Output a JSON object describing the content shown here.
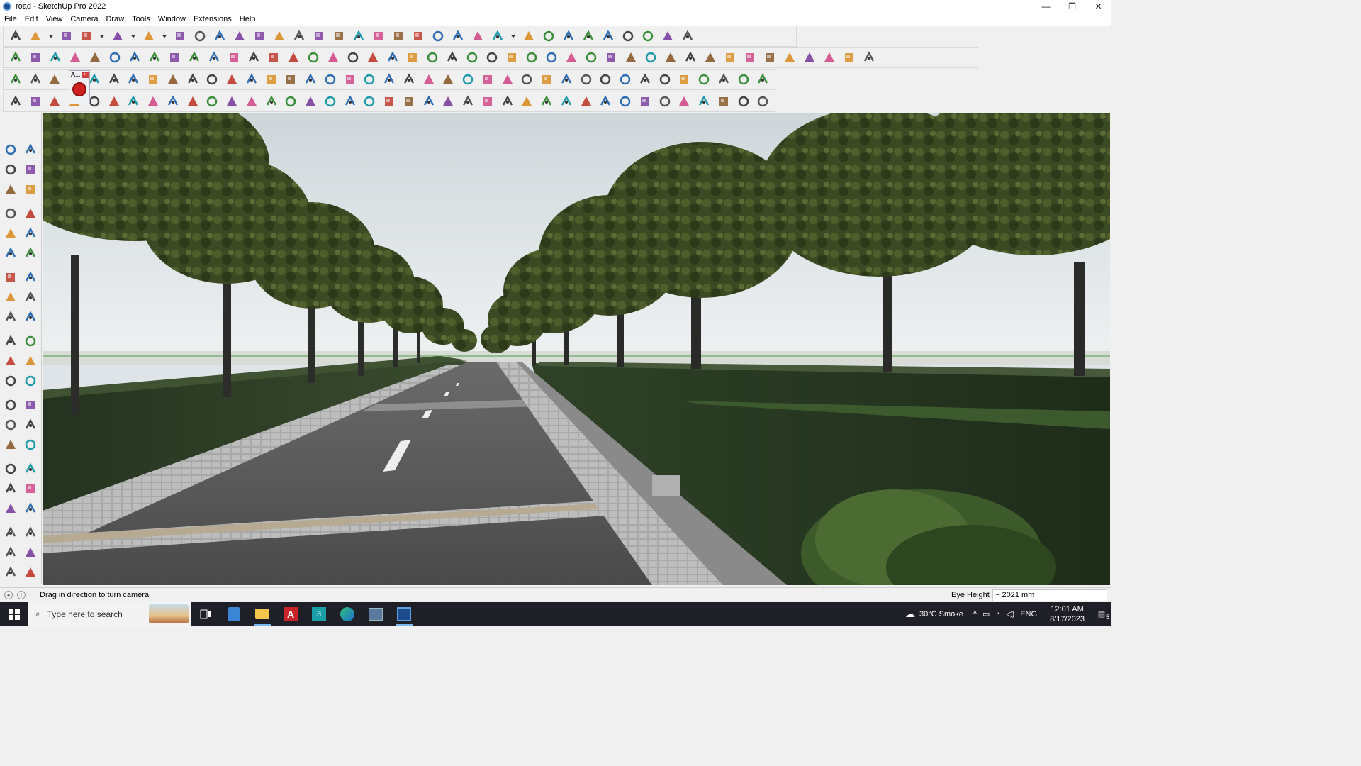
{
  "window": {
    "title": "road - SketchUp Pro 2022",
    "controls": [
      "—",
      "❐",
      "✕"
    ]
  },
  "menu": [
    "File",
    "Edit",
    "View",
    "Camera",
    "Draw",
    "Tools",
    "Window",
    "Extensions",
    "Help"
  ],
  "toolbars": {
    "row1_icons": [
      "zoom-icon",
      "select-icon",
      "dropdown-icon",
      "eraser-icon",
      "pencil-line-icon",
      "dropdown-icon",
      "arc-icon",
      "dropdown-icon",
      "rectangle-icon",
      "dropdown-icon",
      "push-pull-icon",
      "follow-me-icon",
      "move-icon",
      "rotate-icon",
      "scale-icon",
      "tape-measure-icon",
      "text-icon",
      "paint-bucket-icon",
      "orbit-icon",
      "pan-icon",
      "zoom-window-icon",
      "zoom-extents-icon",
      "previous-view-icon",
      "section-plane-icon",
      "section-fill-icon",
      "layers-icon",
      "styles-icon",
      "dropdown-icon",
      "warehouse-icon",
      "extension-warehouse-icon",
      "layout-icon",
      "sandbox-icon",
      "flip-icon",
      "solid-tools-icon",
      "undo-icon",
      "redo-icon",
      "hand-icon"
    ],
    "row2_icons": [
      "iso-view-icon",
      "top-view-icon",
      "front-view-icon",
      "axes-red-icon",
      "axes-blue-icon",
      "axes-purple-icon",
      "axes-green-icon",
      "axes-orange-icon",
      "axes-yellow-icon",
      "axes-pink-icon",
      "smooth-icon",
      "plane-blue-icon",
      "plane-blue-2-icon",
      "plane-purple-icon",
      "green-block-icon",
      "green-block-2-icon",
      "house-icon",
      "house-2-icon",
      "house-3-icon",
      "house-4-icon",
      "house-5-icon",
      "house-6-icon",
      "fx-icon",
      "curve-icon",
      "pencil-red-icon",
      "shape-square-icon",
      "shape-circle-icon",
      "shape-hex-icon",
      "shape-ellipse-icon",
      "shape-parallelogram-icon",
      "shape-arc-icon",
      "shape-spiral-icon",
      "shape-knot-icon",
      "shape-blue-icon",
      "shape-grey-icon",
      "tape-red-icon",
      "eraser-pink-icon",
      "roof-icon",
      "brick-icon",
      "roof-red-icon",
      "roof-gray-icon",
      "roof-white-icon",
      "panel-icon",
      "panel-2-icon"
    ],
    "row3_icons": [
      "blue-box-icon",
      "blue-face-icon",
      "yellow-face-icon",
      "text-label-icon",
      "red-face-icon",
      "flat-face-icon",
      "orange-arc-icon",
      "red-square-icon",
      "stack-icon",
      "frame-icon",
      "wood-icon",
      "link-icon",
      "bend-icon",
      "node-icon",
      "cross-red-icon",
      "cross-green-icon",
      "cross-blue-icon",
      "cone-icon",
      "tent-icon",
      "pyramid-icon",
      "hook-icon",
      "spiral-red-icon",
      "spiral-dark-icon",
      "move-blue-icon",
      "box-red-icon",
      "magnet-icon",
      "tree-icon",
      "cube-arrow-icon",
      "cube-red-icon",
      "cube-yellow-icon",
      "star-icon",
      "gears-icon",
      "window-frame-icon",
      "grid-orange-icon",
      "grid-orange-2-icon",
      "grid-orange-3-icon",
      "dots-icon",
      "dash-circle-icon",
      "multi-grid-icon"
    ],
    "row4_icons": [
      "path-icon",
      "path-red-icon",
      "car-icon",
      "gear-icon",
      "hand-curve-icon",
      "plane-flat-icon",
      "sphere-icon",
      "dome-icon",
      "arc-tool-icon",
      "stairs-icon",
      "stairs-2-icon",
      "line-red-icon",
      "curve-red-icon",
      "wheel-icon",
      "sail-icon",
      "comb-icon",
      "comb-2-icon",
      "hand-grid-icon",
      "leaf-icon",
      "leaf-2-icon",
      "fan-icon",
      "slash-icon",
      "slash-2-icon",
      "slash-3-icon",
      "slash-4-icon",
      "grid-dark-icon",
      "grid-dark-2-icon",
      "grid-dark-3-icon",
      "tile-icon",
      "tile-2-icon",
      "tile-3-icon",
      "hatch-icon",
      "hatch-2-icon",
      "hatch-3-icon",
      "hatch-4-icon",
      "hatch-5-icon",
      "hatch-6-icon",
      "hatch-7-icon",
      "cube-outline-icon"
    ],
    "floating_panel_label": "A..."
  },
  "left_toolbar": [
    "select-icon",
    "orbit-icon",
    "paint-bucket-icon",
    "eraser-icon",
    "component-icon",
    "tape-measure-icon",
    "line-icon",
    "freehand-icon",
    "rectangle-icon",
    "rotated-rectangle-icon",
    "circle-icon",
    "polygon-icon",
    "arc-icon",
    "two-point-arc-icon",
    "pie-icon",
    "three-point-arc-icon",
    "move-icon",
    "push-pull-icon",
    "rotate-icon",
    "follow-me-icon",
    "scale-icon",
    "offset-icon",
    "tape-measure-icon",
    "dimension-icon",
    "protractor-icon",
    "text-icon",
    "axes-icon",
    "3d-text-icon",
    "orbit-icon",
    "pan-icon",
    "zoom-icon",
    "zoom-window-icon",
    "zoom-extents-icon",
    "previous-icon",
    "position-camera-icon",
    "look-around-icon",
    "walk-icon",
    "section-plane-icon",
    "display-section-planes-icon",
    "display-section-cuts-icon",
    "display-section-fill-icon",
    "section-fill-2-icon"
  ],
  "statusbar": {
    "message": "Drag in direction to turn camera",
    "vcb_label": "Eye Height",
    "vcb_value": "~ 2021 mm"
  },
  "taskbar": {
    "search_placeholder": "Type here to search",
    "weather": "30°C  Smoke",
    "language": "ENG",
    "time": "12:01 AM",
    "date": "8/17/2023",
    "notification_count": "5",
    "colors": {
      "bar": "#1f1f27",
      "accent": "#7ab8f5"
    }
  }
}
